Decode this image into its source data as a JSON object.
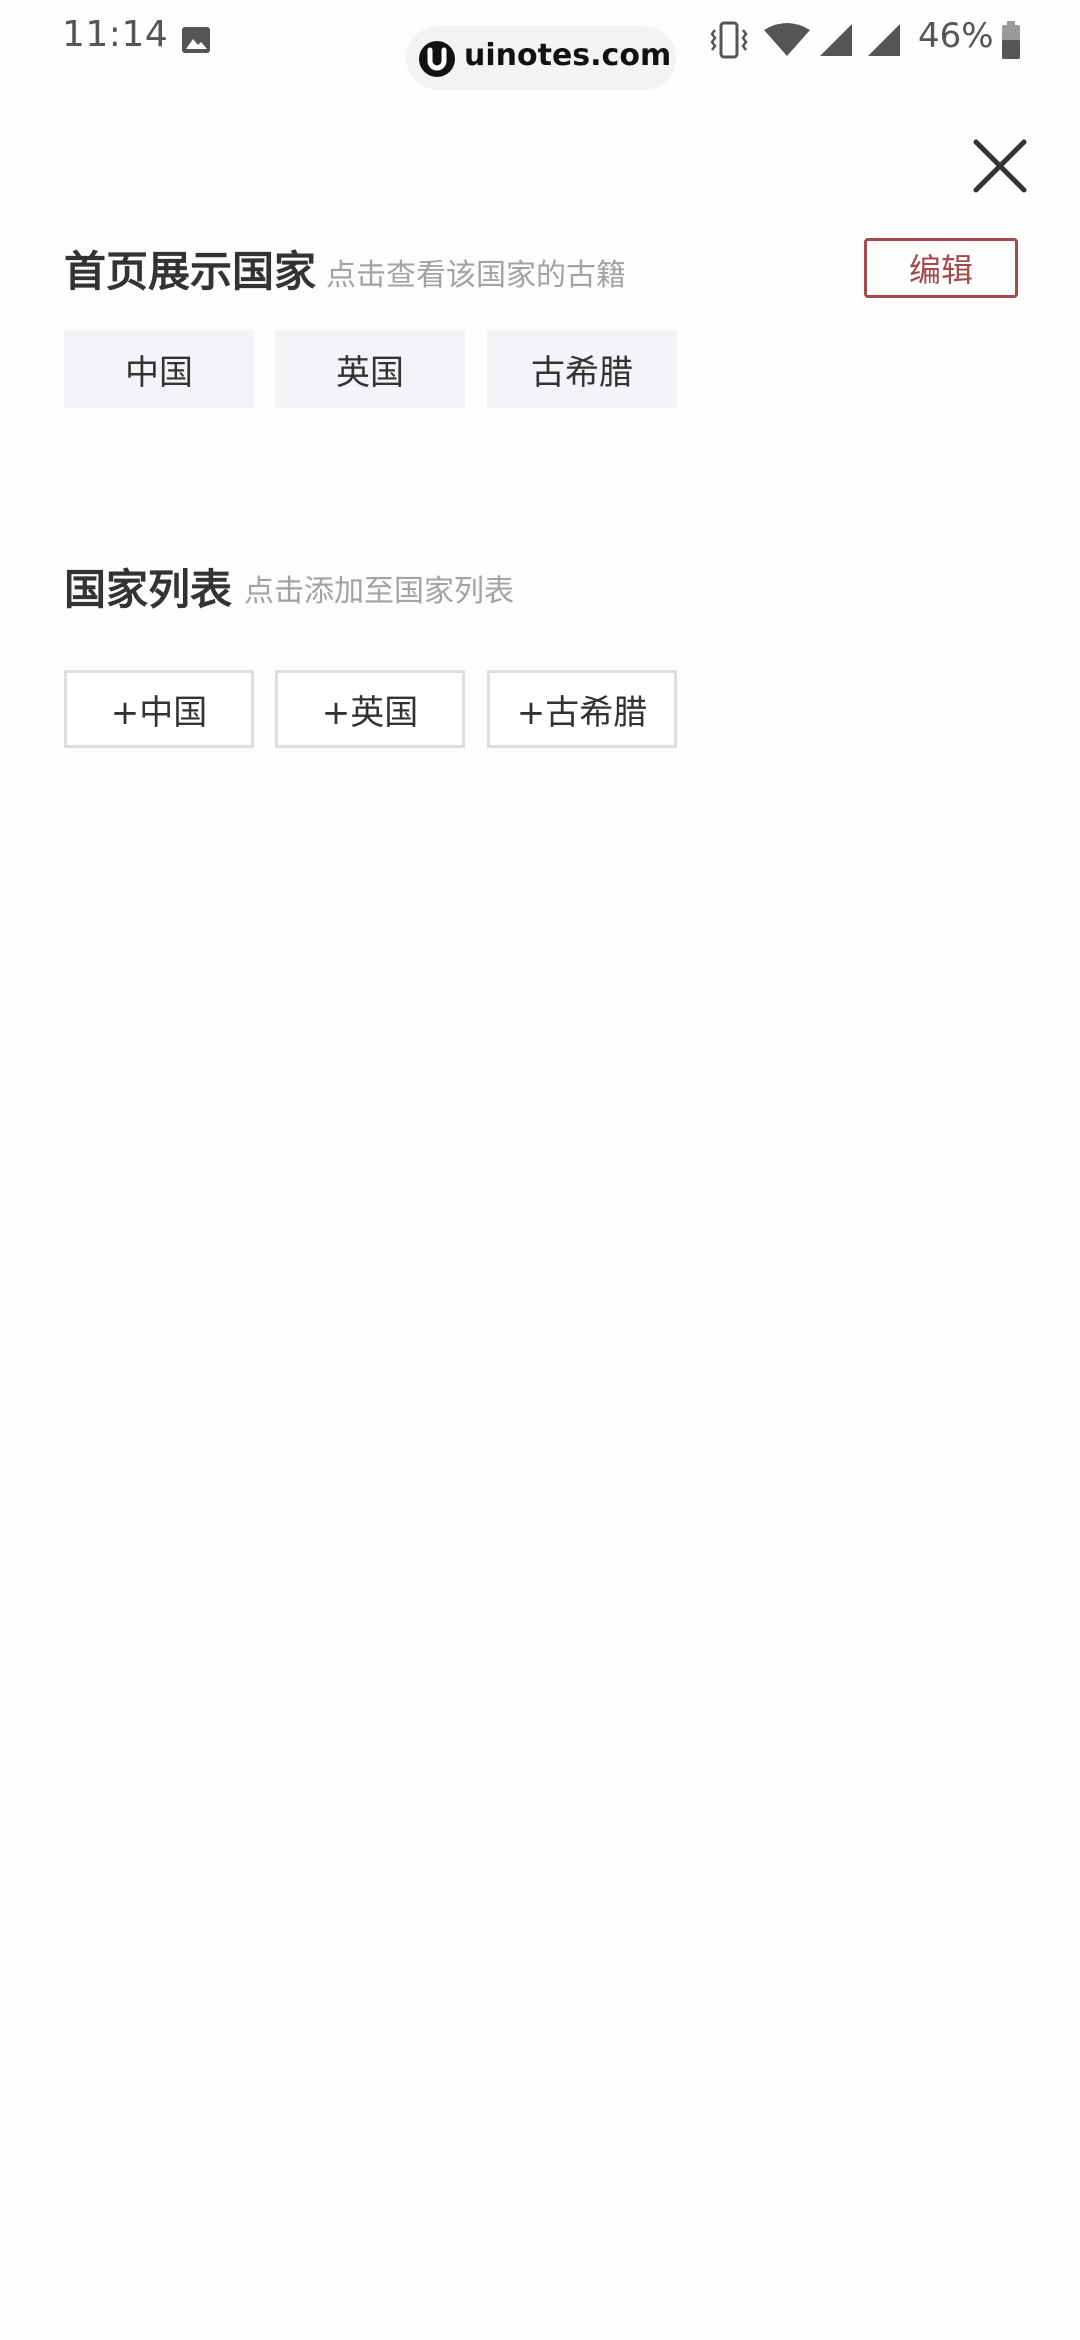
{
  "status_bar": {
    "time": "11:14",
    "battery_percent": "46%",
    "watermark": "uinotes.com",
    "icons": [
      "gallery-icon",
      "vibrate-icon",
      "wifi-icon",
      "signal-icon",
      "signal-icon",
      "battery-icon"
    ]
  },
  "close_icon": "close-icon",
  "home_section": {
    "title": "首页展示国家",
    "hint": "点击查看该国家的古籍",
    "edit_label": "编辑",
    "countries": [
      "中国",
      "英国",
      "古希腊"
    ]
  },
  "list_section": {
    "title": "国家列表",
    "hint": "点击添加至国家列表",
    "countries": [
      "+中国",
      "+英国",
      "+古希腊"
    ]
  },
  "colors": {
    "accent": "#a24a4e",
    "chip_fill": "#f2f4f8",
    "chip_border": "#dedede",
    "hint_text": "#a3a3a3",
    "background": "#fdfdfb"
  }
}
